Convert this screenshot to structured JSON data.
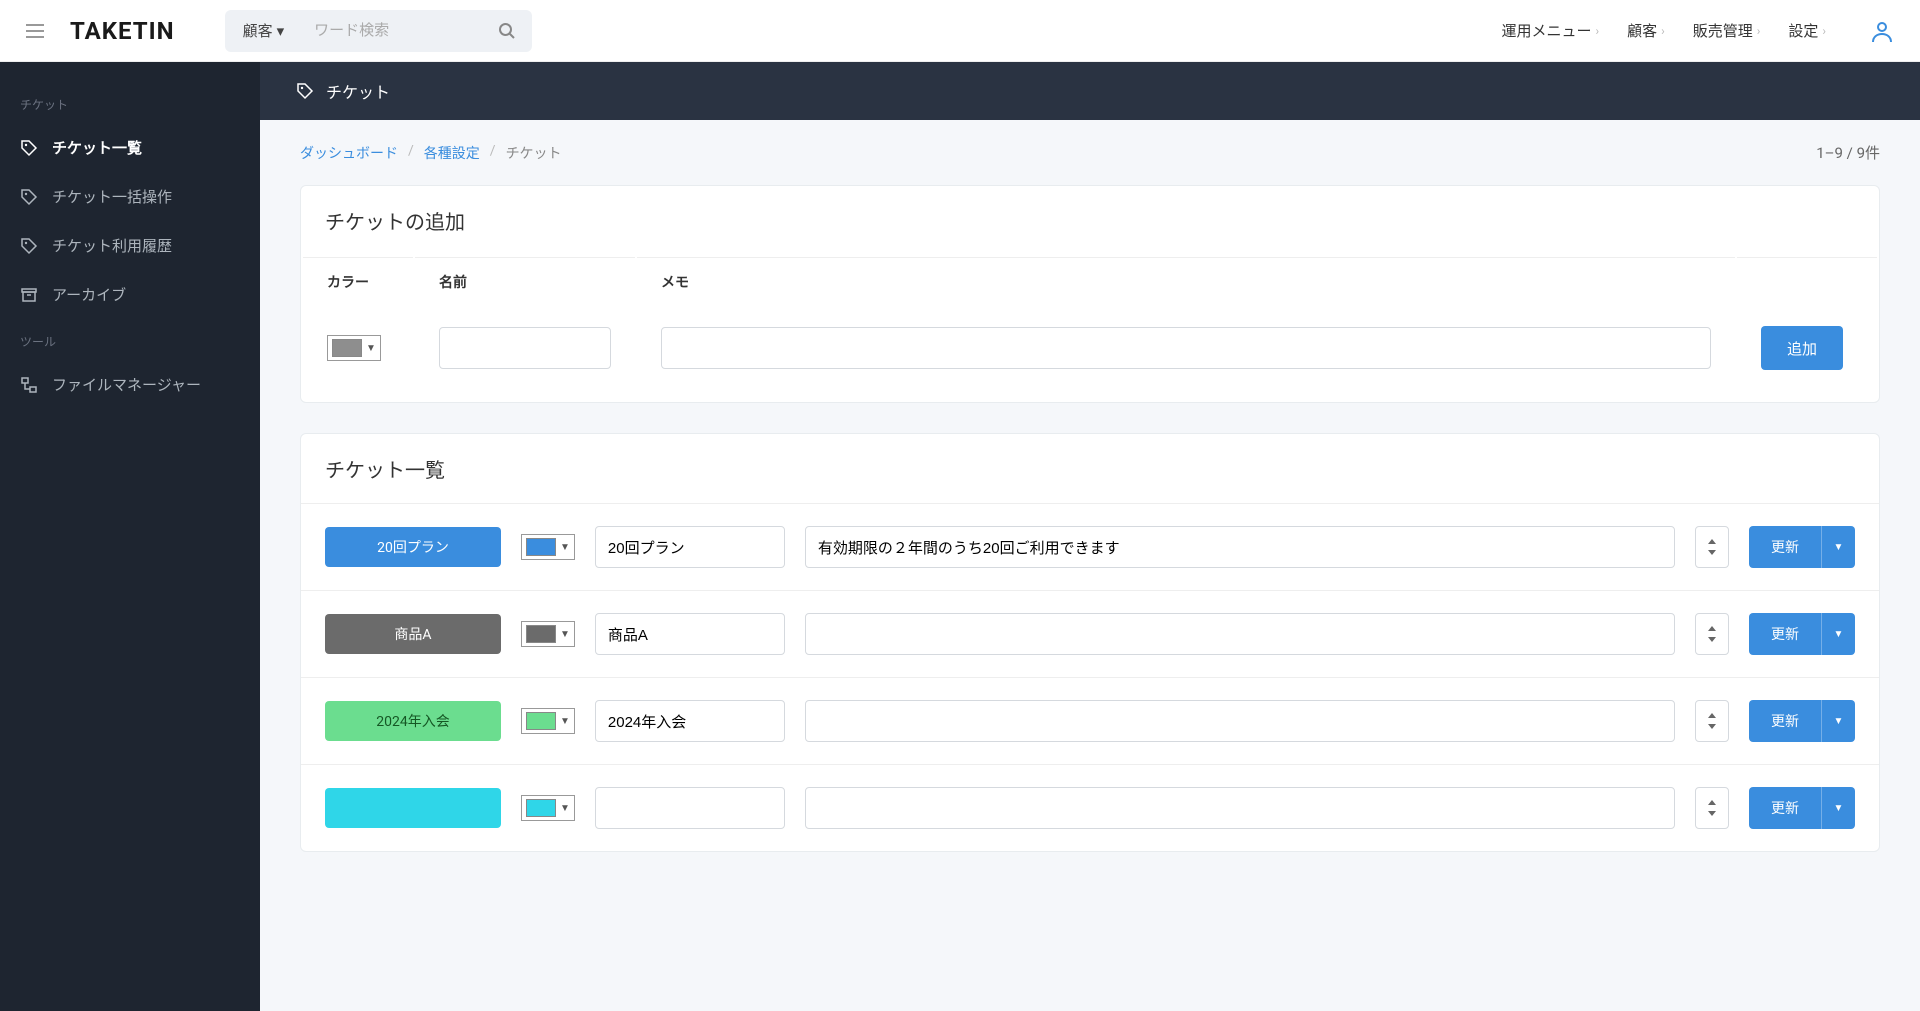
{
  "logo": "TAKETIN",
  "search": {
    "dropdown_label": "顧客",
    "placeholder": "ワード検索"
  },
  "nav": {
    "items": [
      {
        "label": "運用メニュー"
      },
      {
        "label": "顧客"
      },
      {
        "label": "販売管理"
      },
      {
        "label": "設定"
      }
    ]
  },
  "sidebar": {
    "section1_title": "チケット",
    "section2_title": "ツール",
    "items": [
      {
        "label": "チケット一覧"
      },
      {
        "label": "チケット一括操作"
      },
      {
        "label": "チケット利用履歴"
      },
      {
        "label": "アーカイブ"
      },
      {
        "label": "ファイルマネージャー"
      }
    ]
  },
  "page_title": "チケット",
  "breadcrumbs": {
    "dashboard": "ダッシュボード",
    "settings": "各種設定",
    "current": "チケット"
  },
  "count_text": "1–9 / 9件",
  "add_card": {
    "title": "チケットの追加",
    "col_color": "カラー",
    "col_name": "名前",
    "col_memo": "メモ",
    "add_button": "追加",
    "default_color": "#8e8e8e"
  },
  "list_card": {
    "title": "チケット一覧",
    "update_button": "更新"
  },
  "tickets": [
    {
      "label": "20回プラン",
      "name": "20回プラン",
      "memo": "有効期限の２年間のうち20回ご利用できます",
      "badge_bg": "#3a8dde",
      "badge_fg": "#ffffff",
      "swatch": "#3a8dde"
    },
    {
      "label": "商品A",
      "name": "商品A",
      "memo": "",
      "badge_bg": "#6b6b6b",
      "badge_fg": "#ffffff",
      "swatch": "#6b6b6b"
    },
    {
      "label": "2024年入会",
      "name": "2024年入会",
      "memo": "",
      "badge_bg": "#6bdd8f",
      "badge_fg": "#155724",
      "swatch": "#6bdd8f"
    },
    {
      "label": "",
      "name": "",
      "memo": "",
      "badge_bg": "#2fd6e8",
      "badge_fg": "#0c5460",
      "swatch": "#2fd6e8"
    }
  ]
}
